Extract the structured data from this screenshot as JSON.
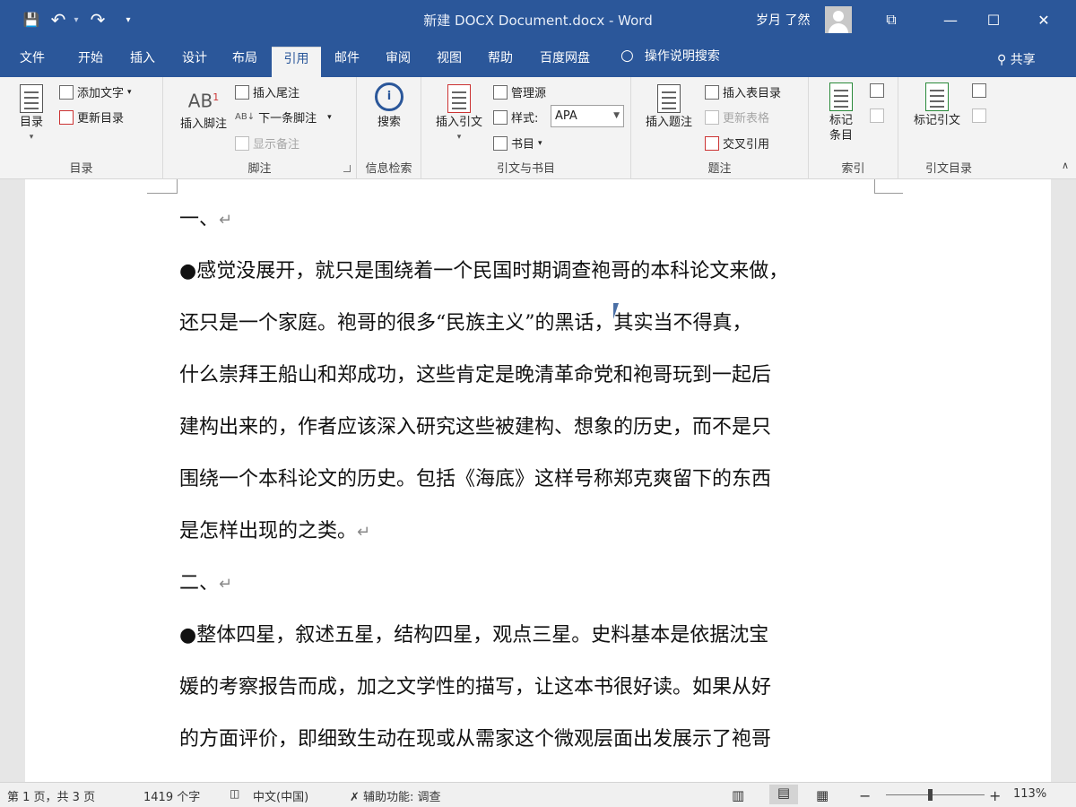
{
  "window": {
    "title": "新建 DOCX Document.docx  -  Word",
    "user": "岁月 了然"
  },
  "qat": {
    "save": "💾",
    "undo": "↶",
    "undo_dd": "▾",
    "redo": "↷",
    "customize": "▾"
  },
  "winctl": {
    "ribbon_opts": "⧉",
    "min": "—",
    "max": "☐",
    "close": "✕"
  },
  "tabs": [
    "文件",
    "开始",
    "插入",
    "设计",
    "布局",
    "引用",
    "邮件",
    "审阅",
    "视图",
    "帮助",
    "百度网盘"
  ],
  "tell_me": "操作说明搜索",
  "share": "共享",
  "ribbon": {
    "toc": {
      "toc_btn": "目录",
      "add_text": "添加文字",
      "update_table": "更新目录",
      "group": "目录"
    },
    "footnotes": {
      "insert_footnote": "插入脚注",
      "insert_endnote": "插入尾注",
      "next_footnote": "下一条脚注",
      "show_notes": "显示备注",
      "group": "脚注",
      "ab": "AB",
      "sup": "1"
    },
    "research": {
      "search": "搜索",
      "group": "信息检索"
    },
    "citations": {
      "insert_citation": "插入引文",
      "manage_sources": "管理源",
      "style_label": "样式:",
      "style_value": "APA",
      "bibliography": "书目",
      "group": "引文与书目"
    },
    "captions": {
      "insert_caption": "插入题注",
      "insert_table_figures": "插入表目录",
      "update_table": "更新表格",
      "cross_ref": "交叉引用",
      "group": "题注"
    },
    "index": {
      "mark_entry": "标记\n条目",
      "group": "索引"
    },
    "toa": {
      "mark_citation": "标记引文",
      "group": "引文目录"
    }
  },
  "document": {
    "paragraphs": [
      {
        "text": "一、",
        "mark": "↵"
      },
      {
        "text": ""
      },
      {
        "text": "●感觉没展开，就只是围绕着一个民国时期调查袍哥的本科论文来做，",
        "mark": ""
      },
      {
        "text": "还只是一个家庭。袍哥的很多“民族主义”的黑话，其实当不得真，",
        "mark": ""
      },
      {
        "text": "什么崇拜王船山和郑成功，这些肯定是晚清革命党和袍哥玩到一起后",
        "mark": ""
      },
      {
        "text": "建构出来的，作者应该深入研究这些被建构、想象的历史，而不是只",
        "mark": ""
      },
      {
        "text": "围绕一个本科论文的历史。包括《海底》这样号称郑克爽留下的东西",
        "mark": ""
      },
      {
        "text": "是怎样出现的之类。",
        "mark": "↵"
      },
      {
        "text": ""
      },
      {
        "text": "二、",
        "mark": "↵"
      },
      {
        "text": ""
      },
      {
        "text": "●整体四星，叙述五星，结构四星，观点三星。史料基本是依据沈宝",
        "mark": ""
      },
      {
        "text": "媛的考察报告而成，加之文学性的描写，让这本书很好读。如果从好",
        "mark": ""
      },
      {
        "text": "的方面评价，即细致生动在现或从需家这个微观层面出发展示了袍哥",
        "mark": ""
      }
    ]
  },
  "status": {
    "page": "第 1 页，共 3 页",
    "words": "1419 个字",
    "lang": "中文(中国)",
    "accessibility": "辅助功能: 调查",
    "zoom": "113%",
    "zoom_minus": "−",
    "zoom_plus": "+"
  }
}
